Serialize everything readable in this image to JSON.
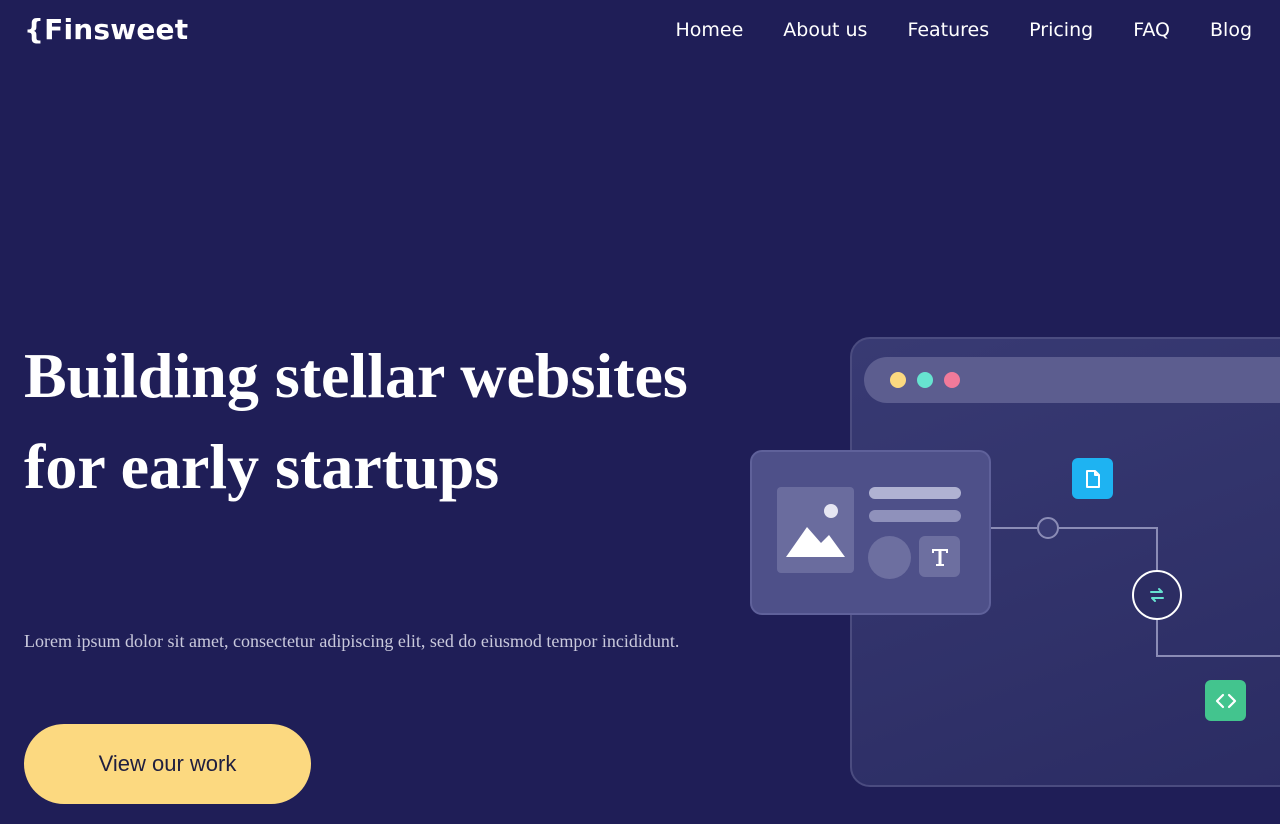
{
  "header": {
    "logo": "{Finsweet",
    "nav": [
      {
        "label": "Homee"
      },
      {
        "label": "About us"
      },
      {
        "label": "Features"
      },
      {
        "label": "Pricing"
      },
      {
        "label": "FAQ"
      },
      {
        "label": "Blog"
      }
    ]
  },
  "hero": {
    "title_line1": "Building stellar websites",
    "title_line2": "for early startups",
    "description": "Lorem ipsum dolor sit amet, consectetur adipiscing elit, sed do eiusmod tempor incididunt.",
    "cta_label": "View our work"
  },
  "illustration": {
    "window_dots": [
      "#fcd980",
      "#67e3d0",
      "#f17a9a"
    ],
    "icons": [
      "image-icon",
      "text-icon",
      "file-icon",
      "sync-icon",
      "code-icon"
    ],
    "colors": {
      "background": "#1f1e57",
      "cta": "#fcd980",
      "file_badge": "#1eb3f2",
      "code_badge": "#43c48e"
    }
  }
}
